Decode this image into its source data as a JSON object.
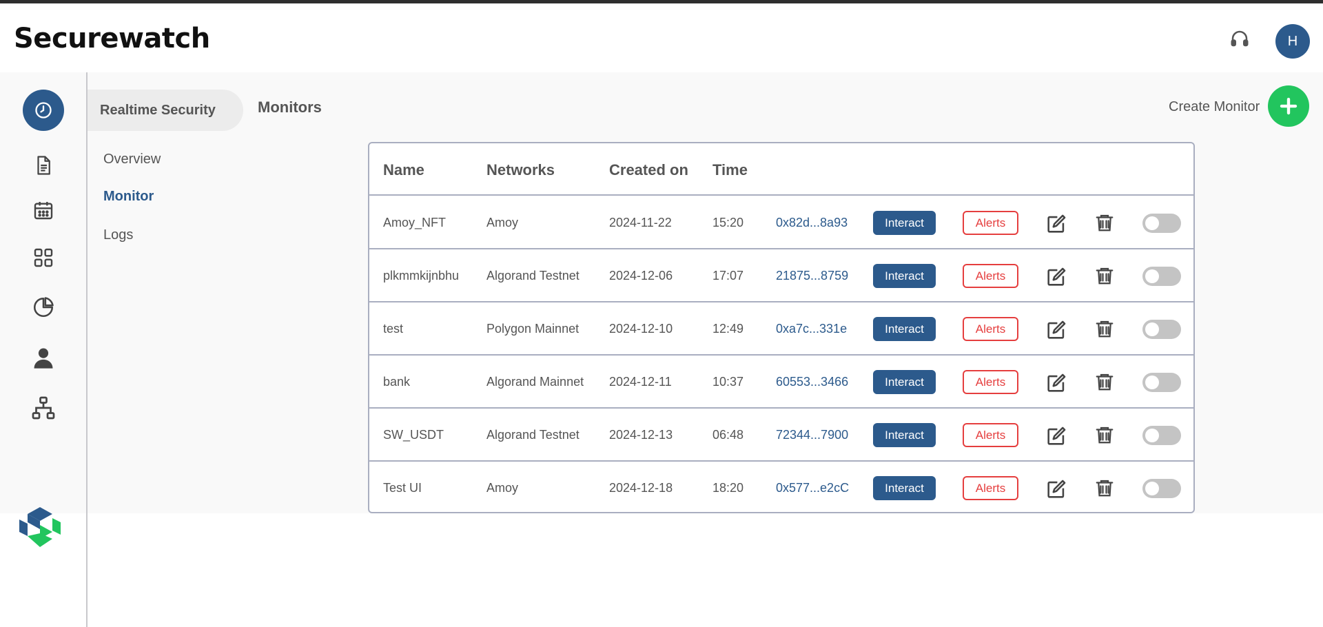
{
  "app": {
    "brand": "Securewatch",
    "avatar_initial": "H"
  },
  "rail": {
    "items": [
      "clock-icon",
      "document-icon",
      "calendar-icon",
      "grid-icon",
      "pie-chart-icon",
      "user-icon",
      "hierarchy-icon"
    ],
    "active": "clock-icon"
  },
  "nav": {
    "section": "Realtime Security",
    "links": [
      "Overview",
      "Monitor",
      "Logs"
    ],
    "active": "Monitor"
  },
  "page": {
    "title": "Monitors",
    "create_label": "Create Monitor"
  },
  "table": {
    "columns": [
      "Name",
      "Networks",
      "Created on",
      "Time"
    ],
    "interact_label": "Interact",
    "alerts_label": "Alerts",
    "rows": [
      {
        "name": "Amoy_NFT",
        "network": "Amoy",
        "created": "2024-11-22",
        "time": "15:20",
        "address": "0x82d...8a93",
        "enabled": false
      },
      {
        "name": "plkmmkijnbhu",
        "network": "Algorand Testnet",
        "created": "2024-12-06",
        "time": "17:07",
        "address": "21875...8759",
        "enabled": false
      },
      {
        "name": "test",
        "network": "Polygon Mainnet",
        "created": "2024-12-10",
        "time": "12:49",
        "address": "0xa7c...331e",
        "enabled": false
      },
      {
        "name": "bank",
        "network": "Algorand Mainnet",
        "created": "2024-12-11",
        "time": "10:37",
        "address": "60553...3466",
        "enabled": false
      },
      {
        "name": "SW_USDT",
        "network": "Algorand Testnet",
        "created": "2024-12-13",
        "time": "06:48",
        "address": "72344...7900",
        "enabled": false
      },
      {
        "name": "Test UI",
        "network": "Amoy",
        "created": "2024-12-18",
        "time": "18:20",
        "address": "0x577...e2cC",
        "enabled": false
      }
    ]
  },
  "colors": {
    "primary": "#2c5a8c",
    "accent_green": "#22c55e",
    "alert_red": "#e53e3e"
  }
}
